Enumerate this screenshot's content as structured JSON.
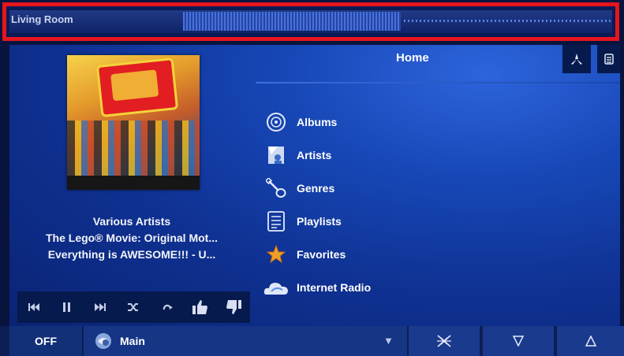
{
  "header": {
    "room_name": "Living Room"
  },
  "now_playing": {
    "artist": "Various Artists",
    "album": "The Lego® Movie: Original Mot...",
    "track": "Everything is AWESOME!!! - U..."
  },
  "transport": [
    "previous-icon",
    "pause-icon",
    "next-icon",
    "shuffle-icon",
    "repeat-icon",
    "thumbs-up-icon",
    "thumbs-down-icon"
  ],
  "home": {
    "title": "Home",
    "menu": [
      {
        "label": "Albums",
        "icon": "disc-icon"
      },
      {
        "label": "Artists",
        "icon": "artist-icon"
      },
      {
        "label": "Genres",
        "icon": "guitar-icon"
      },
      {
        "label": "Playlists",
        "icon": "playlist-icon"
      },
      {
        "label": "Favorites",
        "icon": "star-icon"
      },
      {
        "label": "Internet Radio",
        "icon": "cloud-icon"
      }
    ]
  },
  "footer": {
    "power_label": "OFF",
    "zone_label": "Main",
    "buttons": [
      "mute-icon",
      "volume-down-icon",
      "volume-up-icon"
    ]
  },
  "colors": {
    "accent_red": "#e4161c",
    "panel_blue": "#1747b6",
    "dark_navy": "#071a4e"
  }
}
